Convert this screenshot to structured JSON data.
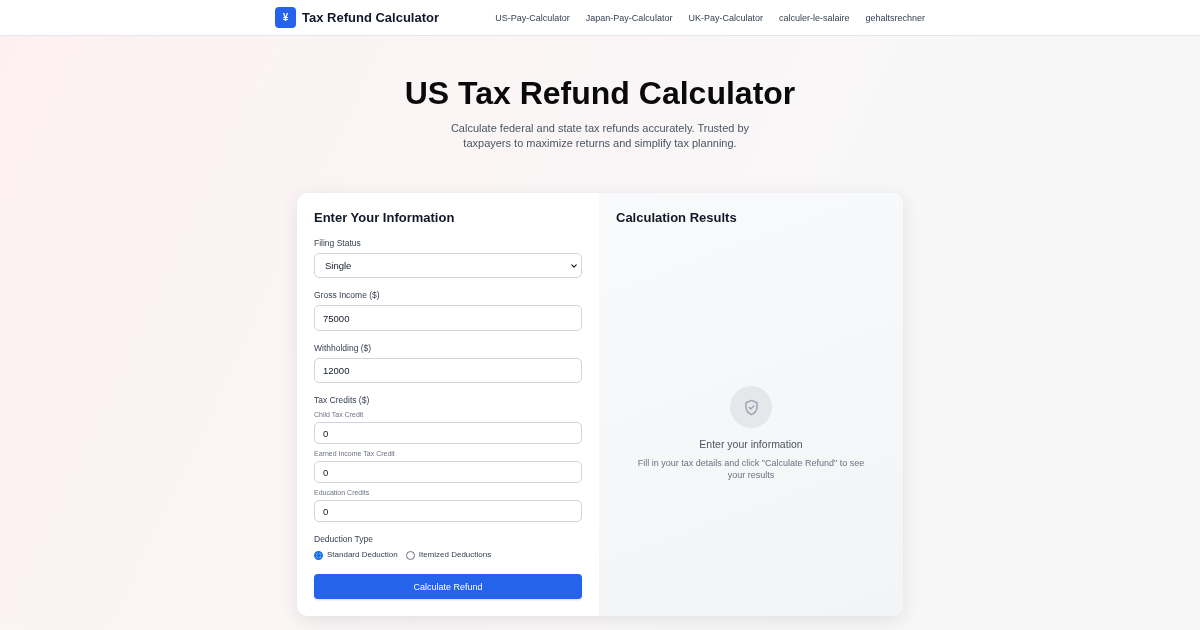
{
  "header": {
    "logo_glyph": "¥",
    "title": "Tax Refund Calculator",
    "nav": [
      {
        "label": "US-Pay-Calculator"
      },
      {
        "label": "Japan-Pay-Calculator"
      },
      {
        "label": "UK-Pay-Calculator"
      },
      {
        "label": "calculer-le-salaire"
      },
      {
        "label": "gehaltsrechner"
      }
    ]
  },
  "hero": {
    "title": "US Tax Refund Calculator",
    "subtitle": "Calculate federal and state tax refunds accurately. Trusted by taxpayers to maximize returns and simplify tax planning."
  },
  "form": {
    "title": "Enter Your Information",
    "fields": [
      {
        "kind": "select",
        "label": "Filing Status",
        "value": "Single"
      },
      {
        "kind": "input",
        "label": "Gross Income ($)",
        "value": "75000"
      },
      {
        "kind": "input",
        "label": "Withholding ($)",
        "value": "12000"
      }
    ],
    "credits": {
      "label": "Tax Credits ($)",
      "items": [
        {
          "label": "Child Tax Credit",
          "value": "0"
        },
        {
          "label": "Earned Income Tax Credit",
          "value": "0"
        },
        {
          "label": "Education Credits",
          "value": "0"
        }
      ]
    },
    "deduction": {
      "label": "Deduction Type",
      "options": [
        {
          "label": "Standard Deduction",
          "selected": true
        },
        {
          "label": "Itemized Deductions",
          "selected": false
        }
      ]
    },
    "submit": "Calculate Refund"
  },
  "results": {
    "title": "Calculation Results",
    "empty_title": "Enter your information",
    "empty_text": "Fill in your tax details and click \"Calculate Refund\" to see your results"
  }
}
